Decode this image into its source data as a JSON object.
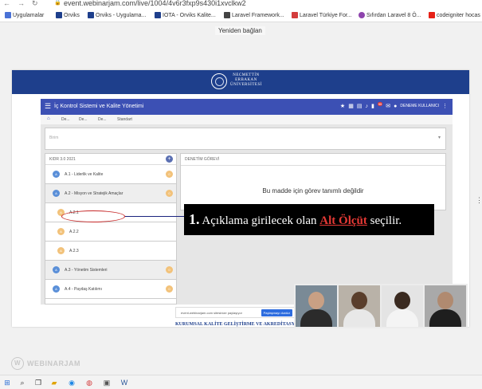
{
  "browser": {
    "url": "event.webinarjam.com/live/1004/4v6r3fxp9s430i1xvclkw2",
    "bookmarks": [
      {
        "label": "Uygulamalar",
        "color": "#4a72d6"
      },
      {
        "label": "Orviks",
        "color": "#1e3f8c"
      },
      {
        "label": "Orviks - Uygulama...",
        "color": "#1e3f8c"
      },
      {
        "label": "IOTA - Orviks Kalite...",
        "color": "#1e3f8c"
      },
      {
        "label": "Laravel Framework...",
        "color": "#444444"
      },
      {
        "label": "Laravel Türkiye For...",
        "color": "#d33c3c"
      },
      {
        "label": "Sıfırdan Laravel 8 Ö...",
        "color": "#8e44ad"
      },
      {
        "label": "codeigniter hocas",
        "color": "#e62117"
      }
    ],
    "reconnect": "Yeniden bağlan"
  },
  "university": {
    "line1": "NECMETTİN",
    "line2": "ERBAKAN",
    "line3": "ÜNİVERSİTESİ"
  },
  "app": {
    "title": "İç Kontrol Sistemi ve Kalite Yönetimi",
    "user": "DENEME KULLANICI",
    "notif_count": "99",
    "breadcrumbs": [
      "De...",
      "De...",
      "De...",
      "Standart"
    ],
    "select_placeholder": "Birim",
    "left_header": "KIDR 3.0 2021",
    "items": [
      {
        "label": "A.1 - Liderlik ve Kalite",
        "circ": "A",
        "count": "0"
      },
      {
        "label": "A.2 - Misyon ve Stratejik Amaçlar",
        "circ": "A",
        "count": "0"
      },
      {
        "label": "A.2.1",
        "circ": "A",
        "count": ""
      },
      {
        "label": "A.2.2",
        "circ": "A",
        "count": ""
      },
      {
        "label": "A.2.3",
        "circ": "A",
        "count": ""
      },
      {
        "label": "A.3 - Yönetim Sistemleri",
        "circ": "A",
        "count": "0"
      },
      {
        "label": "A.4 - Paydaş Katılımı",
        "circ": "A",
        "count": "0"
      }
    ],
    "right_header": "DENETİM GÖREVİ",
    "right_message": "Bu madde için görev tanımlı değildir"
  },
  "callout": {
    "num": "1.",
    "text_before": " Açıklama girilecek olan ",
    "highlight": "Alt Ölçüt",
    "text_after": " seçilir."
  },
  "share": {
    "text": "event.webinarjam.com sitesinize paylaşıyor",
    "button": "Paylaşmayı durdur"
  },
  "footer": "KURUMSAL KALİTE GELİŞTİRME VE AKREDİTASYON",
  "webinarjam": "WEBINARJAM"
}
